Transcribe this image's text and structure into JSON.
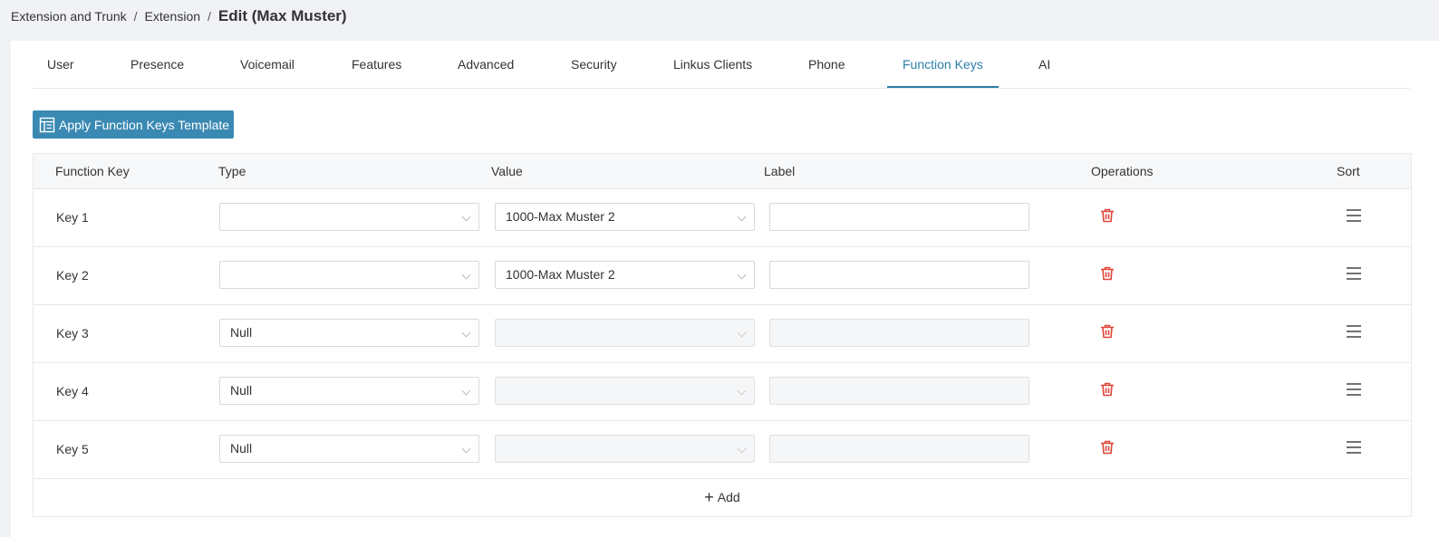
{
  "breadcrumb": {
    "items": [
      "Extension and Trunk",
      "Extension"
    ],
    "separator": "/",
    "current": "Edit (Max Muster)"
  },
  "tabs": [
    {
      "label": "User"
    },
    {
      "label": "Presence"
    },
    {
      "label": "Voicemail"
    },
    {
      "label": "Features"
    },
    {
      "label": "Advanced"
    },
    {
      "label": "Security"
    },
    {
      "label": "Linkus Clients"
    },
    {
      "label": "Phone"
    },
    {
      "label": "Function Keys",
      "active": true
    },
    {
      "label": "AI"
    }
  ],
  "apply_button": {
    "label": "Apply Function Keys Template",
    "icon": "template-icon"
  },
  "table": {
    "columns": {
      "function_key": "Function Key",
      "type": "Type",
      "value": "Value",
      "label": "Label",
      "operations": "Operations",
      "sort": "Sort"
    },
    "rows": [
      {
        "key": "Key 1",
        "type": "",
        "value": "1000-Max Muster 2",
        "label": "",
        "disabled": false
      },
      {
        "key": "Key 2",
        "type": "",
        "value": "1000-Max Muster 2",
        "label": "",
        "disabled": false
      },
      {
        "key": "Key 3",
        "type": "Null",
        "value": "",
        "label": "",
        "disabled": true
      },
      {
        "key": "Key 4",
        "type": "Null",
        "value": "",
        "label": "",
        "disabled": true
      },
      {
        "key": "Key 5",
        "type": "Null",
        "value": "",
        "label": "",
        "disabled": true
      }
    ],
    "add_label": "Add"
  },
  "colors": {
    "accent": "#2b7ea5",
    "button_bg": "#3a89b3",
    "delete": "#e0463a"
  }
}
